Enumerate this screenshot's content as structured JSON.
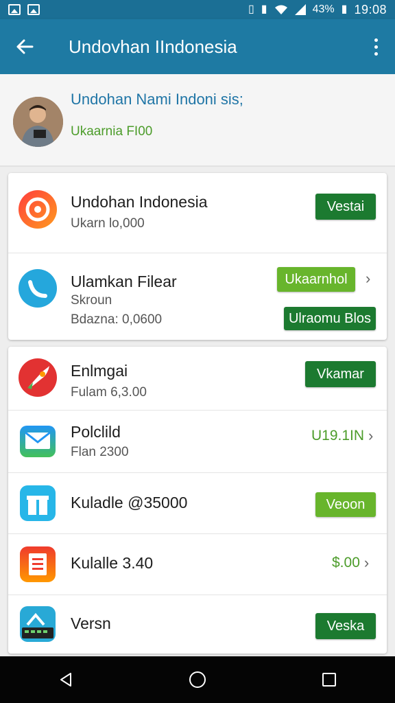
{
  "status_bar": {
    "left_icons": [
      "image-icon",
      "gallery-icon"
    ],
    "right_icons": [
      "vibrate-icon",
      "sim-icon",
      "wifi-icon",
      "signal-icon"
    ],
    "battery_text": "43%",
    "time": "19:08"
  },
  "app_bar": {
    "title": "Undovhan IIndonesia",
    "back_icon": "arrow-left-icon",
    "menu_icon": "more-vertical-icon",
    "color": "#1e7aa3"
  },
  "profile": {
    "name": "Undohan Nami Indoni sis;",
    "subtitle": "Ukaarnia FI00"
  },
  "card1": [
    {
      "icon": "red-circle-app-icon",
      "title": "Undohan Indonesia",
      "subtitle": "Ukarn lo,000",
      "button": "Vestai",
      "button_style": "dark"
    },
    {
      "icon": "blue-phone-app-icon",
      "title": "Ulamkan Filear",
      "subtitle": "Skroun",
      "subtitle2": "Bdazna: 0,0600",
      "button": "Ukaarnhol",
      "button_style": "light",
      "button2": "Ulraomu Blos",
      "chevron": "chevron-right-icon"
    }
  ],
  "card2": [
    {
      "icon": "rocket-app-icon",
      "title": "Enlmgai",
      "subtitle": "Fulam 6,3.00",
      "button": "Vkamar",
      "button_style": "dark"
    },
    {
      "icon": "mail-app-icon",
      "title": "Polclild",
      "subtitle": "Flan 2300",
      "link": "U19.1IN",
      "chevron": "chevron-right-icon"
    },
    {
      "icon": "gift-app-icon",
      "title": "Kuladle @35000",
      "button": "Veoon",
      "button_style": "light"
    },
    {
      "icon": "clipboard-app-icon",
      "title": "Kulalle 3.40",
      "link": "$.00",
      "chevron": "chevron-right-icon"
    },
    {
      "icon": "keyboard-app-icon",
      "title": "Versn",
      "button": "Veska",
      "button_style": "dark"
    }
  ],
  "nav": {
    "back": "nav-back-icon",
    "home": "nav-home-icon",
    "recents": "nav-recents-icon"
  },
  "colors": {
    "dark_green": "#1c7a30",
    "light_green": "#68b52c",
    "link_green": "#4c9c2a"
  }
}
